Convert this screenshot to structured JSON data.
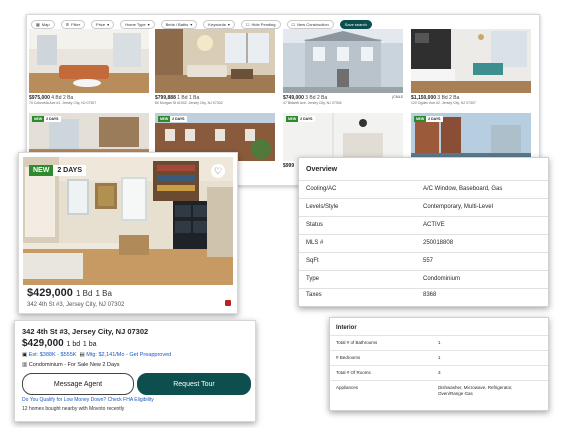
{
  "toolbar": {
    "items": [
      "Map",
      "Filter",
      "Price",
      "Home Type",
      "Beds / Baths",
      "Keywords",
      "Hide Pending",
      "New Construction"
    ],
    "save_search": "Save search"
  },
  "listings_row1": [
    {
      "price": "$975,000",
      "beds": "4 Bd",
      "baths": "2 Ba",
      "address": "70 Columbia Ave #1, Jersey City, NJ 07307"
    },
    {
      "price": "$799,888",
      "beds": "1 Bd",
      "baths": "1 Ba",
      "address": "80 Morgan St #1002, Jersey City, NJ 07302"
    },
    {
      "price": "$749,000",
      "beds": "3 Bd",
      "baths": "2 Ba",
      "address": "47 Bidwell Ave, Jersey City, NJ 07304",
      "mark": "jCMLS"
    },
    {
      "price": "$1,150,000",
      "beds": "3 Bd",
      "baths": "2 Ba",
      "address": "120 Ogden Ave #2, Jersey City, NJ 07307"
    }
  ],
  "listings_row2": [
    {
      "new": "NEW",
      "days": "2 DAYS"
    },
    {
      "new": "NEW",
      "days": "2 DAYS"
    },
    {
      "new": "NEW",
      "days": "2 DAYS",
      "price_partial": "$999"
    },
    {
      "new": "NEW",
      "days": "2 DAYS"
    }
  ],
  "feature": {
    "new": "NEW",
    "days": "2 DAYS",
    "price": "$429,000",
    "beds": "1 Bd",
    "baths": "1 Ba",
    "address": "342 4th St #3, Jersey City, NJ 07302"
  },
  "overview": {
    "title": "Overview",
    "rows": [
      {
        "k": "Cooling/AC",
        "v": "A/C Window, Baseboard, Gas"
      },
      {
        "k": "Levels/Style",
        "v": "Contemporary, Multi-Level"
      },
      {
        "k": "Status",
        "v": "ACTIVE"
      },
      {
        "k": "MLS #",
        "v": "250018808"
      },
      {
        "k": "SqFt",
        "v": "557"
      },
      {
        "k": "Type",
        "v": "Condominium"
      },
      {
        "k": "Taxes",
        "v": "8368"
      }
    ]
  },
  "contact": {
    "address": "342 4th St #3, Jersey City, NJ 07302",
    "price": "$429,000",
    "beds": "1 bd",
    "baths": "1 ba",
    "est_label": "Est: $388K - $555K",
    "mtg_label": "Mtg: $2,141/Mo - Get Preapproved",
    "type_status": "Condominium - For Sale New 2 Days",
    "message_agent": "Message Agent",
    "request_tour": "Request Tour",
    "fha_link": "Do You Qualify for Low Money Down? Check FHA Eligibility",
    "bought_nearby": "12 homes bought nearby with Movoto recently"
  },
  "interior": {
    "title": "Interior",
    "rows": [
      {
        "k": "Total # of Bathrooms",
        "v": "1"
      },
      {
        "k": "# Bedrooms",
        "v": "1"
      },
      {
        "k": "Total # Of Rooms",
        "v": "3"
      },
      {
        "k": "Appliances",
        "v": "Dishwasher, Microwave, Refrigerator, Oven/Range Gas"
      }
    ]
  },
  "colors": {
    "accent": "#0d4f4f",
    "link": "#1a59c4",
    "new_badge": "#2e8b2e"
  }
}
